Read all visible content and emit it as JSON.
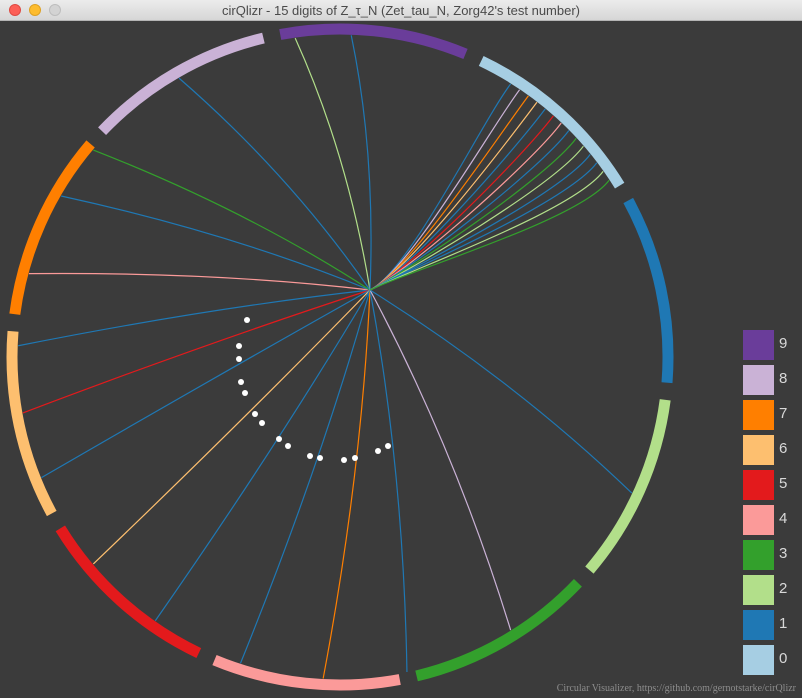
{
  "window": {
    "title": "cirQlizr - 15 digits of Z_τ_N (Zet_tau_N, Zorg42's test number)"
  },
  "colors": {
    "background": "#3b3b3b",
    "digits": [
      "#a6cee3",
      "#1f78b4",
      "#b2df8a",
      "#33a02c",
      "#fb9a99",
      "#e31a1c",
      "#fdbf6f",
      "#ff7f00",
      "#cab2d6",
      "#6a3d9a"
    ]
  },
  "legend": [
    {
      "label": "9",
      "color": "#6a3d9a"
    },
    {
      "label": "8",
      "color": "#cab2d6"
    },
    {
      "label": "7",
      "color": "#ff7f00"
    },
    {
      "label": "6",
      "color": "#fdbf6f"
    },
    {
      "label": "5",
      "color": "#e31a1c"
    },
    {
      "label": "4",
      "color": "#fb9a99"
    },
    {
      "label": "3",
      "color": "#33a02c"
    },
    {
      "label": "2",
      "color": "#b2df8a"
    },
    {
      "label": "1",
      "color": "#1f78b4"
    },
    {
      "label": "0",
      "color": "#a6cee3"
    }
  ],
  "footer": {
    "credit": "Circular Visualizer, https://github.com/gernotstarke/cirQlizr"
  }
}
